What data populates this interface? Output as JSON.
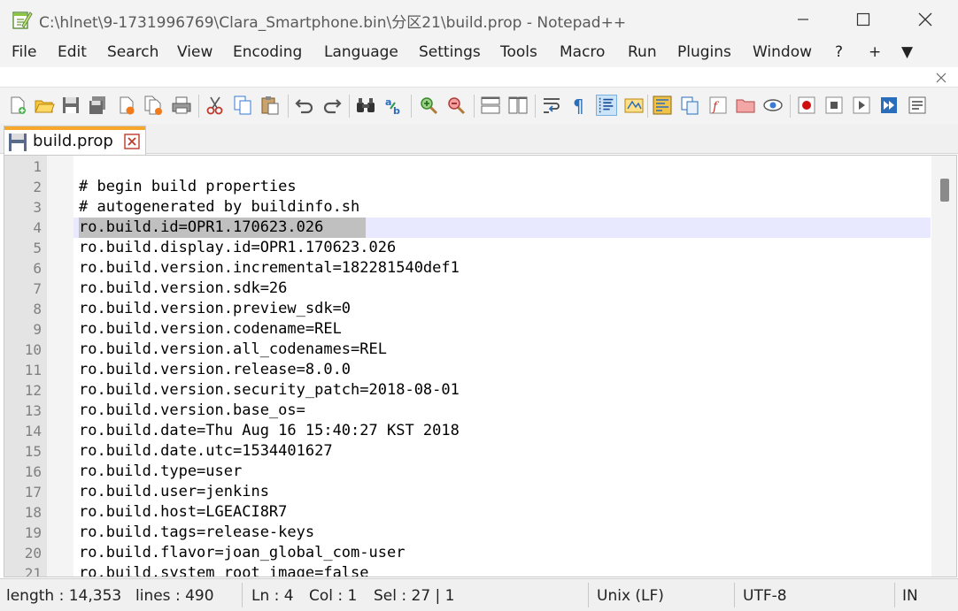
{
  "window": {
    "title": "C:\\hlnet\\9-1731996769\\Clara_Smartphone.bin\\分区21\\build.prop - Notepad++",
    "app_icon": "notepadpp-icon",
    "controls": [
      "minimize-icon",
      "maximize-icon",
      "close-icon"
    ]
  },
  "menu": {
    "items": [
      "File",
      "Edit",
      "Search",
      "View",
      "Encoding",
      "Language",
      "Settings",
      "Tools",
      "Macro",
      "Run",
      "Plugins",
      "Window",
      "?",
      "+",
      "▼"
    ]
  },
  "toolbar": {
    "icons": [
      "new-file-icon",
      "open-file-icon",
      "save-icon",
      "save-all-icon",
      "close-file-icon",
      "close-all-icon",
      "print-icon",
      "cut-icon",
      "copy-icon",
      "paste-icon",
      "undo-icon",
      "redo-icon",
      "find-icon",
      "replace-icon",
      "zoom-in-icon",
      "zoom-out-icon",
      "sync-vertical-icon",
      "sync-horizontal-icon",
      "word-wrap-icon",
      "show-all-chars-icon",
      "indent-guide-icon",
      "udl-icon",
      "doc-map-icon",
      "doc-list-icon",
      "function-list-icon",
      "folder-workspace-icon",
      "monitor-icon",
      "record-macro-icon",
      "stop-record-icon",
      "play-macro-icon",
      "run-macro-multiple-icon",
      "save-macro-icon"
    ]
  },
  "tab": {
    "label": "build.prop",
    "accent_color": "#f7a82a"
  },
  "editor": {
    "current_line": 4,
    "lines": [
      {
        "n": "1",
        "text": ""
      },
      {
        "n": "2",
        "text": "# begin build properties"
      },
      {
        "n": "3",
        "text": "# autogenerated by buildinfo.sh"
      },
      {
        "n": "4",
        "text": "ro.build.id=OPR1.170623.026"
      },
      {
        "n": "5",
        "text": "ro.build.display.id=OPR1.170623.026"
      },
      {
        "n": "6",
        "text": "ro.build.version.incremental=182281540def1"
      },
      {
        "n": "7",
        "text": "ro.build.version.sdk=26"
      },
      {
        "n": "8",
        "text": "ro.build.version.preview_sdk=0"
      },
      {
        "n": "9",
        "text": "ro.build.version.codename=REL"
      },
      {
        "n": "10",
        "text": "ro.build.version.all_codenames=REL"
      },
      {
        "n": "11",
        "text": "ro.build.version.release=8.0.0"
      },
      {
        "n": "12",
        "text": "ro.build.version.security_patch=2018-08-01"
      },
      {
        "n": "13",
        "text": "ro.build.version.base_os="
      },
      {
        "n": "14",
        "text": "ro.build.date=Thu Aug 16 15:40:27 KST 2018"
      },
      {
        "n": "15",
        "text": "ro.build.date.utc=1534401627"
      },
      {
        "n": "16",
        "text": "ro.build.type=user"
      },
      {
        "n": "17",
        "text": "ro.build.user=jenkins"
      },
      {
        "n": "18",
        "text": "ro.build.host=LGEACI8R7"
      },
      {
        "n": "19",
        "text": "ro.build.tags=release-keys"
      },
      {
        "n": "20",
        "text": "ro.build.flavor=joan_global_com-user"
      },
      {
        "n": "21",
        "text": "ro.build.system_root_image=false"
      }
    ]
  },
  "status": {
    "length": "length : 14,353",
    "lines": "lines : 490",
    "ln": "Ln : 4",
    "col": "Col : 1",
    "sel": "Sel : 27 | 1",
    "eol": "Unix (LF)",
    "encoding": "UTF-8",
    "mode": "IN"
  }
}
